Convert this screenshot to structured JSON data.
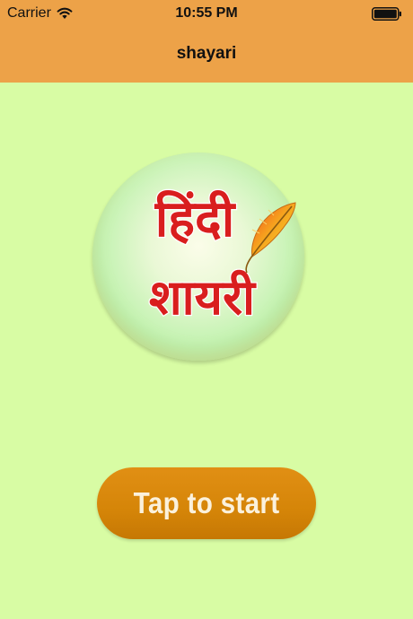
{
  "status_bar": {
    "carrier": "Carrier",
    "time": "10:55 PM",
    "wifi_icon": "wifi-icon",
    "battery_icon": "battery-icon"
  },
  "nav": {
    "title": "shayari"
  },
  "logo": {
    "line1": "हिंदी",
    "line2": "शायरी",
    "feather_icon": "feather-icon"
  },
  "start_button": {
    "label": "Tap to start"
  },
  "colors": {
    "background": "#d8fca4",
    "nav_bar": "#eda248",
    "button": "#d88a0c",
    "logo_text": "#d91e1e"
  }
}
